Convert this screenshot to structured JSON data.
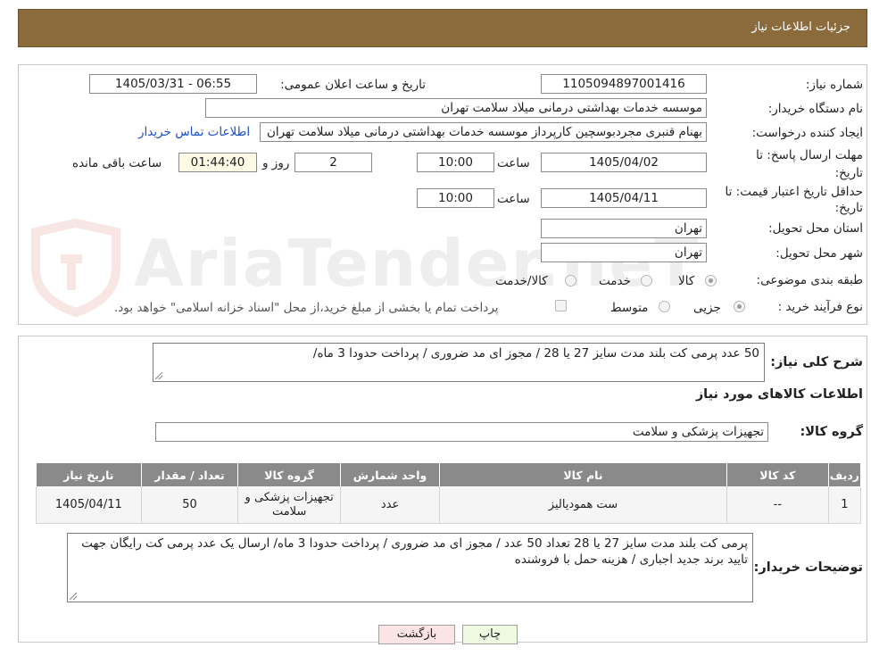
{
  "header": {
    "title": "جزئیات اطلاعات نیاز"
  },
  "watermark": {
    "text": "AriaTender.neT"
  },
  "form": {
    "need_number_label": "شماره نیاز:",
    "need_number": "1105094897001416",
    "announce_label": "تاریخ و ساعت اعلان عمومی:",
    "announce_value": "1405/03/31 - 06:55",
    "buyer_label": "نام دستگاه خریدار:",
    "buyer_value": "موسسه خدمات بهداشتی درمانی میلاد سلامت تهران",
    "creator_label": "ایجاد کننده درخواست:",
    "creator_value": "بهنام قنبری مجردبوسچین کارپرداز موسسه خدمات بهداشتی درمانی میلاد سلامت تهران",
    "contact_link": "اطلاعات تماس خریدار",
    "reply_deadline_label": "مهلت ارسال پاسخ: تا تاریخ:",
    "reply_date": "1405/04/02",
    "time_label": "ساعت",
    "reply_time": "10:00",
    "days_value": "2",
    "days_label": "روز و",
    "remaining_time": "01:44:40",
    "remaining_label": "ساعت باقی مانده",
    "validity_label": "حداقل تاریخ اعتبار قیمت: تا تاریخ:",
    "validity_date": "1405/04/11",
    "validity_time": "10:00",
    "province_label": "استان محل تحویل:",
    "province_value": "تهران",
    "city_label": "شهر محل تحویل:",
    "city_value": "تهران",
    "category_label": "طبقه بندی موضوعی:",
    "category_options": [
      "کالا",
      "خدمت",
      "کالا/خدمت"
    ],
    "category_selected": "کالا",
    "process_label": "نوع فرآیند خرید :",
    "process_options": [
      "جزیی",
      "متوسط"
    ],
    "process_selected": "جزیی",
    "treasury_note": "پرداخت تمام یا بخشی از مبلغ خرید،از محل \"اسناد خزانه اسلامی\" خواهد بود."
  },
  "description": {
    "label": "شرح کلی نیاز:",
    "value": "50 عدد پرمی کت بلند مدت سایز 27 یا 28    /   مجوز ای مد ضروری / پرداخت حدودا 3 ماه/"
  },
  "goods_info": {
    "title": "اطلاعات کالاهای مورد نیاز",
    "group_label": "گروه کالا:",
    "group_value": "تجهیزات پزشکی و سلامت"
  },
  "table": {
    "headers": [
      "ردیف",
      "کد کالا",
      "نام کالا",
      "واحد شمارش",
      "گروه کالا",
      "تعداد / مقدار",
      "تاریخ نیاز"
    ],
    "rows": [
      [
        "1",
        "--",
        "ست همودیالیز",
        "عدد",
        "تجهیزات پزشکی و سلامت",
        "50",
        "1405/04/11"
      ]
    ]
  },
  "buyer_notes": {
    "label": "توضیحات خریدار:",
    "value": "پرمی کت بلند مدت سایز 27 یا 28 تعداد 50 عدد   /   مجوز ای مد ضروری / پرداخت حدودا 3 ماه/ ارسال یک عدد پرمی کت رایگان جهت  تایید برند جدید اجباری  / هزینه حمل با فروشنده"
  },
  "buttons": {
    "print": "چاپ",
    "back": "بازگشت"
  },
  "colors": {
    "header_bg": "#8b6a3c",
    "table_header_bg": "#8a8a8a",
    "back_button_bg": "#fde4e4",
    "print_button_bg": "#eef9e2",
    "link": "#1a4fd0"
  }
}
